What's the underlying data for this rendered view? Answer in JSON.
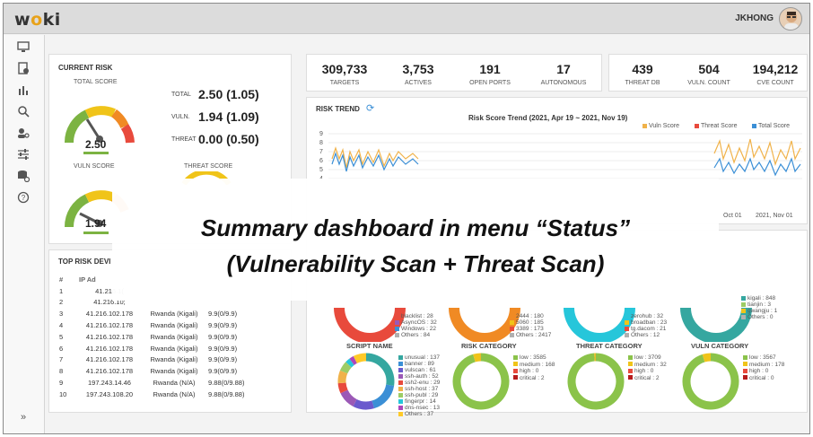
{
  "app": {
    "logo_pre": "w",
    "logo_o": "o",
    "logo_post": "ki",
    "user": "JKHONG"
  },
  "overlay": {
    "line1": "Summary dashboard in menu “Status”",
    "line2": "(Vulnerability Scan + Threat Scan)"
  },
  "current_risk": {
    "title": "CURRENT RISK",
    "total_label": "TOTAL SCORE",
    "total_value": "2.50",
    "vuln_label": "VULN SCORE",
    "vuln_value": "1.94",
    "threat_label": "THREAT SCORE",
    "rows": [
      {
        "label": "TOTAL",
        "value": "2.50 (1.05)"
      },
      {
        "label": "VULN.",
        "value": "1.94 (1.09)"
      },
      {
        "label": "THREAT",
        "value": "0.00 (0.50)"
      }
    ],
    "gauge_ticks": [
      "0",
      "4",
      "7",
      "9",
      "10"
    ]
  },
  "stats_left": [
    {
      "value": "309,733",
      "label": "TARGETS"
    },
    {
      "value": "3,753",
      "label": "ACTIVES"
    },
    {
      "value": "191",
      "label": "OPEN PORTS"
    },
    {
      "value": "17",
      "label": "AUTONOMOUS"
    }
  ],
  "stats_right": [
    {
      "value": "439",
      "label": "THREAT DB"
    },
    {
      "value": "504",
      "label": "VULN. COUNT"
    },
    {
      "value": "194,212",
      "label": "CVE COUNT"
    }
  ],
  "risk_trend": {
    "title": "RISK TREND",
    "chart_title": "Risk Score Trend (2021, Apr 19 ~ 2021, Nov 19)",
    "legend": [
      {
        "name": "Vuln Score",
        "color": "#f0b24a"
      },
      {
        "name": "Threat Score",
        "color": "#e84a3c"
      },
      {
        "name": "Total Score",
        "color": "#3b8fd6"
      }
    ],
    "y_ticks": [
      "9",
      "8",
      "7",
      "6",
      "5",
      "4"
    ],
    "x_ticks": [
      "Oct 01",
      "2021, Nov 01"
    ]
  },
  "top_risk": {
    "title": "TOP RISK DEVI",
    "headers": [
      "#",
      "IP Ad"
    ],
    "rows": [
      [
        "1",
        "41.216.1(",
        "",
        ""
      ],
      [
        "2",
        "41.216.10;",
        "",
        ""
      ],
      [
        "3",
        "41.216.102.178",
        "Rwanda (Kigali)",
        "9.9(0/9.9)"
      ],
      [
        "4",
        "41.216.102.178",
        "Rwanda (Kigali)",
        "9.9(0/9.9)"
      ],
      [
        "5",
        "41.216.102.178",
        "Rwanda (Kigali)",
        "9.9(0/9.9)"
      ],
      [
        "6",
        "41.216.102.178",
        "Rwanda (Kigali)",
        "9.9(0/9.9)"
      ],
      [
        "7",
        "41.216.102.178",
        "Rwanda (Kigali)",
        "9.9(0/9.9)"
      ],
      [
        "8",
        "41.216.102.178",
        "Rwanda (Kigali)",
        "9.9(0/9.9)"
      ],
      [
        "9",
        "197.243.14.46",
        "Rwanda (N/A)",
        "9.88(0/9.88)"
      ],
      [
        "10",
        "197.243.108.20",
        "Rwanda (N/A)",
        "9.88(0/9.88)"
      ]
    ]
  },
  "donuts_top": {
    "legend_1": [
      "blacklist : 28",
      "AsyncOS : 32",
      "Windows : 22",
      "Others : 84"
    ],
    "legend_2": [
      "2444 : 180",
      "5060 : 185",
      "3389 : 173",
      "Others : 2417"
    ],
    "legend_3": [
      "zerohub : 32",
      "broadban : 23",
      "tg.dacom : 21",
      "Others : 12"
    ],
    "legend_4": [
      "kigali : 848",
      "tianjin : 3",
      "gwangju : 1",
      "Others : 0"
    ]
  },
  "categories": [
    {
      "title": "SCRIPT NAME",
      "legend": [
        "unusual : 137",
        "banner : 89",
        "vulscan : 61",
        "ssh-auth : 52",
        "ssh2-enu : 29",
        "ssh-host : 37",
        "ssh-publ : 29",
        "fingerpr : 14",
        "dns-nsec : 13",
        "Others : 37"
      ],
      "colors": [
        "#35a7a0",
        "#3b8fd6",
        "#6a5acd",
        "#9b59b6",
        "#e84a3c",
        "#f0b24a",
        "#9ccc65",
        "#26c6da",
        "#ab47bc",
        "#ffca28"
      ]
    },
    {
      "title": "RISK CATEGORY",
      "legend": [
        "low : 3585",
        "medium : 168",
        "high : 0",
        "critical : 2"
      ],
      "colors": [
        "#8bc34a",
        "#f0c419",
        "#e84a3c",
        "#b71c1c"
      ]
    },
    {
      "title": "THREAT CATEGORY",
      "legend": [
        "low : 3709",
        "medium : 32",
        "high : 0",
        "critical : 2"
      ],
      "colors": [
        "#8bc34a",
        "#f0c419",
        "#e84a3c",
        "#b71c1c"
      ]
    },
    {
      "title": "VULN CATEGORY",
      "legend": [
        "low : 3567",
        "medium : 178",
        "high : 0",
        "critical : 0"
      ],
      "colors": [
        "#8bc34a",
        "#f0c419",
        "#e84a3c",
        "#b71c1c"
      ]
    }
  ],
  "sidebar_collapse": "»"
}
